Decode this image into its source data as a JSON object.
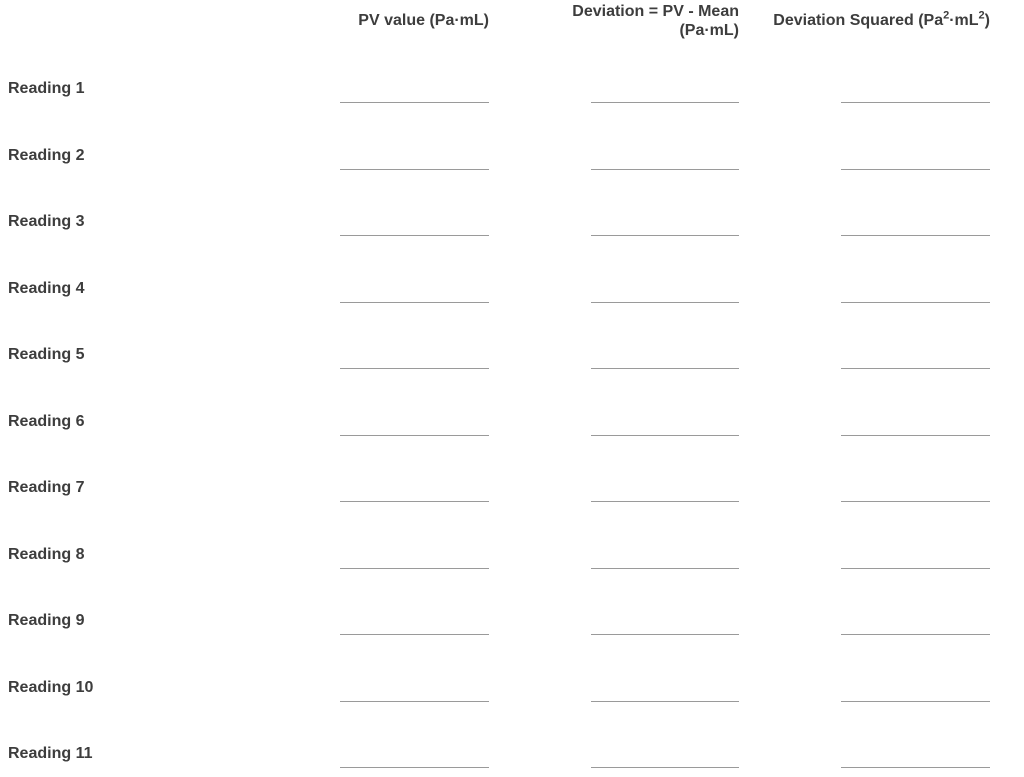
{
  "headers": {
    "pv_value": "PV value (Pa·mL)",
    "deviation_line1": "Deviation = PV - Mean",
    "deviation_line2": "(Pa·mL)",
    "dev_sq_prefix": "Deviation Squared (Pa",
    "dev_sq_sup1": "2",
    "dev_sq_mid": "·mL",
    "dev_sq_sup2": "2",
    "dev_sq_suffix": ")"
  },
  "rows": [
    {
      "label": "Reading 1",
      "pv": "",
      "deviation": "",
      "deviation_squared": ""
    },
    {
      "label": "Reading 2",
      "pv": "",
      "deviation": "",
      "deviation_squared": ""
    },
    {
      "label": "Reading 3",
      "pv": "",
      "deviation": "",
      "deviation_squared": ""
    },
    {
      "label": "Reading 4",
      "pv": "",
      "deviation": "",
      "deviation_squared": ""
    },
    {
      "label": "Reading 5",
      "pv": "",
      "deviation": "",
      "deviation_squared": ""
    },
    {
      "label": "Reading 6",
      "pv": "",
      "deviation": "",
      "deviation_squared": ""
    },
    {
      "label": "Reading 7",
      "pv": "",
      "deviation": "",
      "deviation_squared": ""
    },
    {
      "label": "Reading 8",
      "pv": "",
      "deviation": "",
      "deviation_squared": ""
    },
    {
      "label": "Reading 9",
      "pv": "",
      "deviation": "",
      "deviation_squared": ""
    },
    {
      "label": "Reading 10",
      "pv": "",
      "deviation": "",
      "deviation_squared": ""
    },
    {
      "label": "Reading 11",
      "pv": "",
      "deviation": "",
      "deviation_squared": ""
    }
  ]
}
